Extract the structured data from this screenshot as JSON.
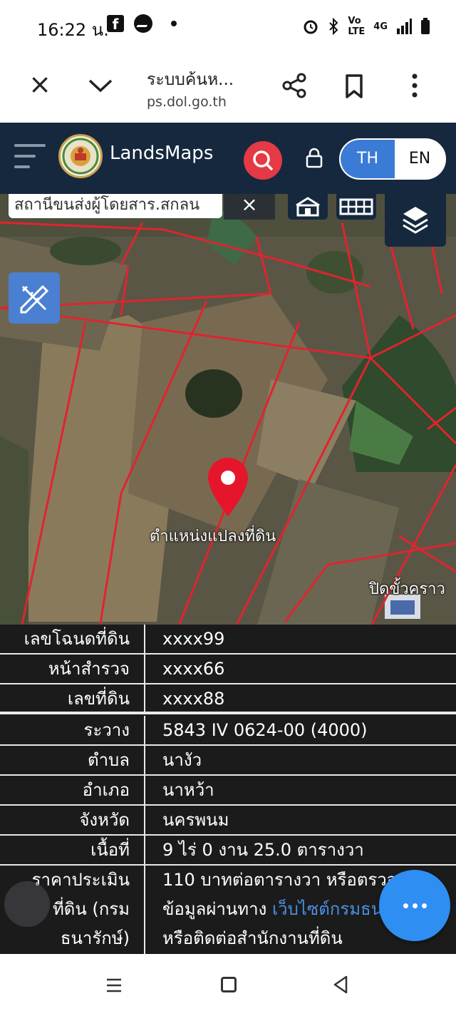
{
  "status_bar": {
    "time": "16:22 น.",
    "fb_icon": "facebook-icon",
    "network": "4G"
  },
  "browser": {
    "title": "ระบบค้นห...",
    "url": "ps.dol.go.th"
  },
  "header": {
    "app_name": "LandsMaps",
    "lang_th": "TH",
    "lang_en": "EN"
  },
  "map": {
    "search_value": "สถานีขนส่งผู้โดยสาร.สกลน",
    "clear_label": "×",
    "pin_label": "ตำแหน่งแปลงที่ดิน",
    "road_label": "ปิดขั้วคราว"
  },
  "parcel": {
    "rows": [
      {
        "label": "เลขโฉนดที่ดิน",
        "value": "xxxx99"
      },
      {
        "label": "หน้าสำรวจ",
        "value": "xxxx66"
      },
      {
        "label": "เลขที่ดิน",
        "value": "xxxx88"
      },
      {
        "label": "ระวาง",
        "value": "5843 IV 0624-00 (4000)"
      },
      {
        "label": "ตำบล",
        "value": "นางัว"
      },
      {
        "label": "อำเภอ",
        "value": "นาหว้า"
      },
      {
        "label": "จังหวัด",
        "value": "นครพนม"
      },
      {
        "label": "เนื้อที่",
        "value": "9 ไร่ 0 งาน 25.0 ตารางวา"
      }
    ],
    "price_label_1": "ราคาประเมิน",
    "price_label_2": "ที่ดิน (กรม",
    "price_label_3": "ธนารักษ์)",
    "price_value_1": "110 บาทต่อตารางวา หรือตรวจสอบ",
    "price_value_2a": "ข้อมูลผ่านทาง ",
    "price_value_2b": "เว็บไซต์กรมธนารักษ์",
    "price_value_3": "หรือติดต่อสำนักงานที่ดิน"
  },
  "colors": {
    "header_bg": "#16283e",
    "search_red": "#e53945",
    "toggle_blue": "#3a7bd5",
    "parcel_line": "#e0242f",
    "fab_blue": "#2e8ef2"
  }
}
